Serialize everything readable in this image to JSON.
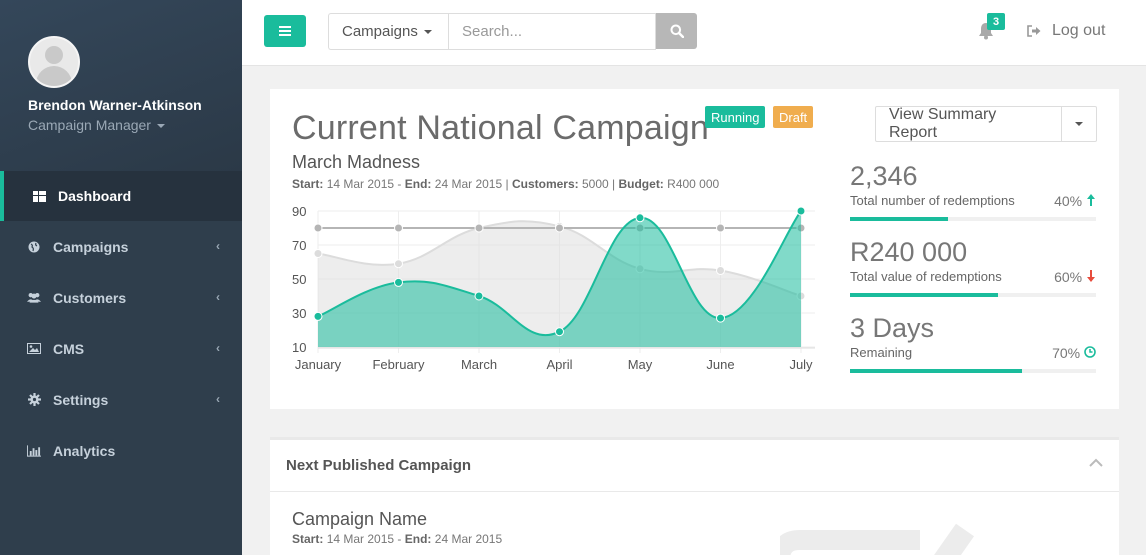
{
  "user": {
    "name": "Brendon Warner-Atkinson",
    "role": "Campaign Manager"
  },
  "nav": [
    {
      "label": "Dashboard",
      "icon": "dashboard-icon",
      "active": true
    },
    {
      "label": "Campaigns",
      "icon": "globe-icon"
    },
    {
      "label": "Customers",
      "icon": "users-icon"
    },
    {
      "label": "CMS",
      "icon": "image-icon"
    },
    {
      "label": "Settings",
      "icon": "gear-icon"
    },
    {
      "label": "Analytics",
      "icon": "bar-chart-icon"
    }
  ],
  "topbar": {
    "scope": "Campaigns",
    "search_placeholder": "Search...",
    "notifications": "3",
    "logout": "Log out"
  },
  "campaign": {
    "title": "Current National Campaign",
    "status_running": "Running",
    "status_draft": "Draft",
    "name": "March Madness",
    "meta": {
      "start_label": "Start:",
      "start": "14 Mar 2015",
      "end_label": "End:",
      "end": "24 Mar 2015",
      "customers_label": "Customers:",
      "customers": "5000",
      "budget_label": "Budget:",
      "budget": "R400 000"
    },
    "report_button": "View Summary Report",
    "stats": [
      {
        "value": "2,346",
        "label": "Total number of redemptions",
        "percent": "40%",
        "progress": 40,
        "trend": "up",
        "color": "#1abc9c"
      },
      {
        "value": "R240 000",
        "label": "Total value of redemptions",
        "percent": "60%",
        "progress": 60,
        "trend": "down",
        "color": "#e74c3c"
      },
      {
        "value": "3 Days",
        "label": "Remaining",
        "percent": "70%",
        "progress": 70,
        "trend": "clock",
        "color": "#1abc9c"
      }
    ]
  },
  "chart_data": {
    "type": "area",
    "categories": [
      "January",
      "February",
      "March",
      "April",
      "May",
      "June",
      "July"
    ],
    "yticks": [
      10,
      30,
      50,
      70,
      90
    ],
    "ylim": [
      10,
      90
    ],
    "grid": true,
    "series": [
      {
        "values": [
          65,
          59,
          80,
          81,
          56,
          55,
          40
        ],
        "color": "#dcdcdc",
        "fill": "rgba(220,220,220,0.5)"
      },
      {
        "values": [
          80,
          80,
          80,
          80,
          80,
          80,
          80
        ],
        "color": "#b5b5b5",
        "fill": "none"
      },
      {
        "values": [
          28,
          48,
          40,
          19,
          86,
          27,
          90
        ],
        "color": "#1abc9c",
        "fill": "rgba(26,188,156,0.55)"
      }
    ]
  },
  "next_campaign": {
    "header": "Next Published Campaign",
    "name": "Campaign Name",
    "start_label": "Start:",
    "start": "14 Mar 2015",
    "end_label": "End:",
    "end": "24 Mar 2015"
  }
}
